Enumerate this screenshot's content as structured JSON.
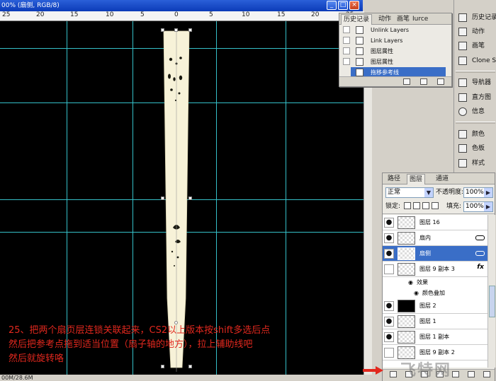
{
  "document": {
    "title": "00% (扇侧, RGB/8)",
    "status": "00M/28.6M",
    "ruler_labels": [
      "25",
      "20",
      "15",
      "10",
      "5",
      "0",
      "5",
      "10",
      "15",
      "20",
      "25"
    ],
    "canvas_color": "#000000",
    "guide_color": "#35c0c8",
    "instruction_lines": [
      "25、把两个扇页层连锁关联起来，CS2以上版本按shift多选后点",
      "然后把参考点拖到适当位置（扇子轴的地方），拉上辅助线吧",
      "然后就旋转咯"
    ],
    "instruction_color": "#e2281e"
  },
  "history_panel": {
    "tabs": [
      "历史记录",
      "动作",
      "画笔",
      "Iurce"
    ],
    "items": [
      {
        "label": "Unlink Layers"
      },
      {
        "label": "Link Layers"
      },
      {
        "label": "图层属性"
      },
      {
        "label": "图层属性"
      },
      {
        "label": "拖移参考线",
        "selected": true
      }
    ]
  },
  "dock": {
    "items": [
      "历史记录",
      "动作",
      "画笔",
      "Clone Sou",
      "导航器",
      "直方图",
      "信息",
      "颜色",
      "色板",
      "样式"
    ]
  },
  "layers_panel": {
    "tabs": [
      "路径",
      "图层",
      "通道"
    ],
    "blend_mode": "正常",
    "opacity_label": "不透明度:",
    "opacity_value": "100%",
    "lock_label": "锁定:",
    "fill_label": "填充:",
    "fill_value": "100%",
    "layers": [
      {
        "name": "图层 16",
        "visible": true
      },
      {
        "name": "扇内",
        "visible": true,
        "linked": true
      },
      {
        "name": "扇侧",
        "visible": true,
        "linked": true,
        "selected": true
      },
      {
        "name": "图层 9 副本 3",
        "visible": false,
        "fx": true
      },
      {
        "name": "图层 2",
        "visible": true,
        "black": true
      },
      {
        "name": "图层 1",
        "visible": true
      },
      {
        "name": "图层 1 副本",
        "visible": true
      },
      {
        "name": "图层 9 副本 2",
        "visible": false
      }
    ],
    "effects_label": "效果",
    "effect_name": "颜色叠加",
    "fx_symbol": "fx",
    "watermark": "飞特网"
  }
}
